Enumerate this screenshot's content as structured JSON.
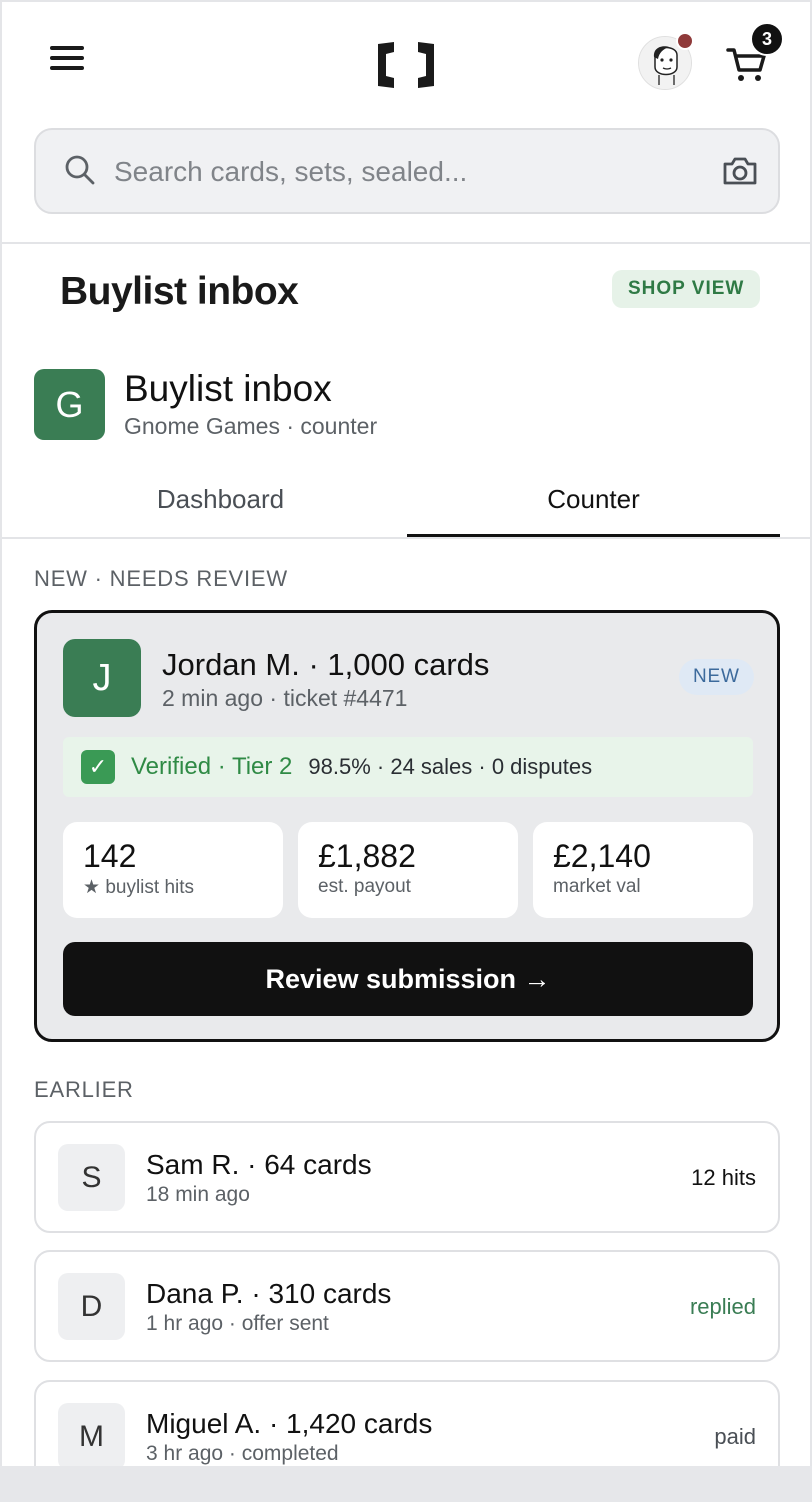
{
  "header": {
    "cart_count": "3",
    "search": {
      "placeholder": "Search cards, sets, sealed..."
    }
  },
  "page": {
    "title": "Buylist inbox",
    "shop_view_label": "SHOP VIEW"
  },
  "shop": {
    "initial": "G",
    "title": "Buylist inbox",
    "subtitle": "Gnome Games · counter"
  },
  "tabs": [
    {
      "label": "Dashboard",
      "active": false
    },
    {
      "label": "Counter",
      "active": true
    }
  ],
  "sections": {
    "new_label": "NEW · NEEDS REVIEW",
    "earlier_label": "EARLIER"
  },
  "featured": {
    "initial": "J",
    "name": "Jordan M. · 1,000 cards",
    "meta": "2 min ago · ticket #4471",
    "badge": "NEW",
    "verified_label": "Verified · Tier 2",
    "verified_stats": "98.5% · 24 sales · 0 disputes",
    "stats": [
      {
        "value": "142",
        "label": "buylist hits",
        "icon": "star-icon"
      },
      {
        "value": "£1,882",
        "label": "est. payout"
      },
      {
        "value": "£2,140",
        "label": "market val"
      }
    ],
    "cta": "Review submission →"
  },
  "earlier": [
    {
      "initial": "S",
      "name": "Sam R. · 64 cards",
      "meta": "18 min ago",
      "status": "12 hits"
    },
    {
      "initial": "D",
      "name": "Dana P. · 310 cards",
      "meta": "1 hr ago · offer sent",
      "status": "replied"
    },
    {
      "initial": "M",
      "name": "Miguel A. · 1,420 cards",
      "meta": "3 hr ago · completed",
      "status": "paid"
    }
  ],
  "colors": {
    "accent_green": "#3a7d54",
    "new_badge_bg": "#dfe9f5",
    "verified_bg": "#e8f4ea",
    "notification_dot": "#8f3a3a"
  }
}
